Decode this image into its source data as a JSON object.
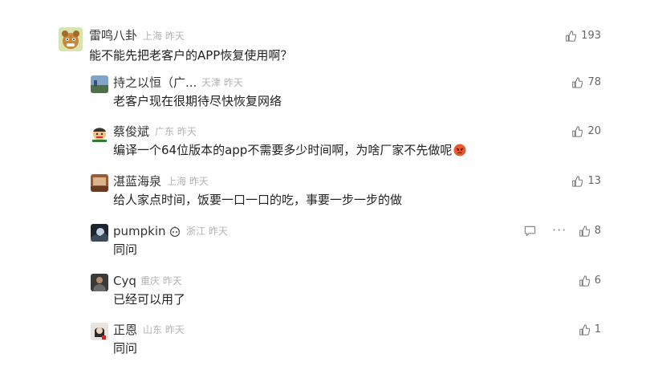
{
  "comments": [
    {
      "user": "雷鸣八卦",
      "location": "上海",
      "time": "昨天",
      "text": "能不能先把老客户的APP恢复使用啊？",
      "likes": "193",
      "avatar": "cartoon-bear-avatar"
    },
    {
      "user": "持之以恒（广...",
      "location": "天津",
      "time": "昨天",
      "text": "老客户现在很期待尽快恢复网络",
      "likes": "78",
      "avatar": "landscape-avatar"
    },
    {
      "user": "蔡俊斌",
      "location": "广东",
      "time": "昨天",
      "text": "编译一个64位版本的app不需要多少时间啊，为啥厂家不先做呢",
      "likes": "20",
      "avatar": "cartoon-face-avatar"
    },
    {
      "user": "湛蓝海泉",
      "location": "上海",
      "time": "昨天",
      "text": "给人家点时间，饭要一口一口的吃，事要一步一步的做",
      "likes": "13",
      "avatar": "photo-avatar"
    },
    {
      "user": "pumpkin",
      "location": "浙江",
      "time": "昨天",
      "text": "同问",
      "likes": "8",
      "avatar": "night-scene-avatar"
    },
    {
      "user": "Cyq",
      "location": "重庆",
      "time": "昨天",
      "text": "已经可以用了",
      "likes": "6",
      "avatar": "person-photo-avatar"
    },
    {
      "user": "正恩",
      "location": "山东",
      "time": "昨天",
      "text": "同问",
      "likes": "1",
      "avatar": "girl-photo-avatar"
    }
  ],
  "colors": {
    "text": "#222222",
    "meta": "#b3b3b3",
    "like": "#666666"
  }
}
